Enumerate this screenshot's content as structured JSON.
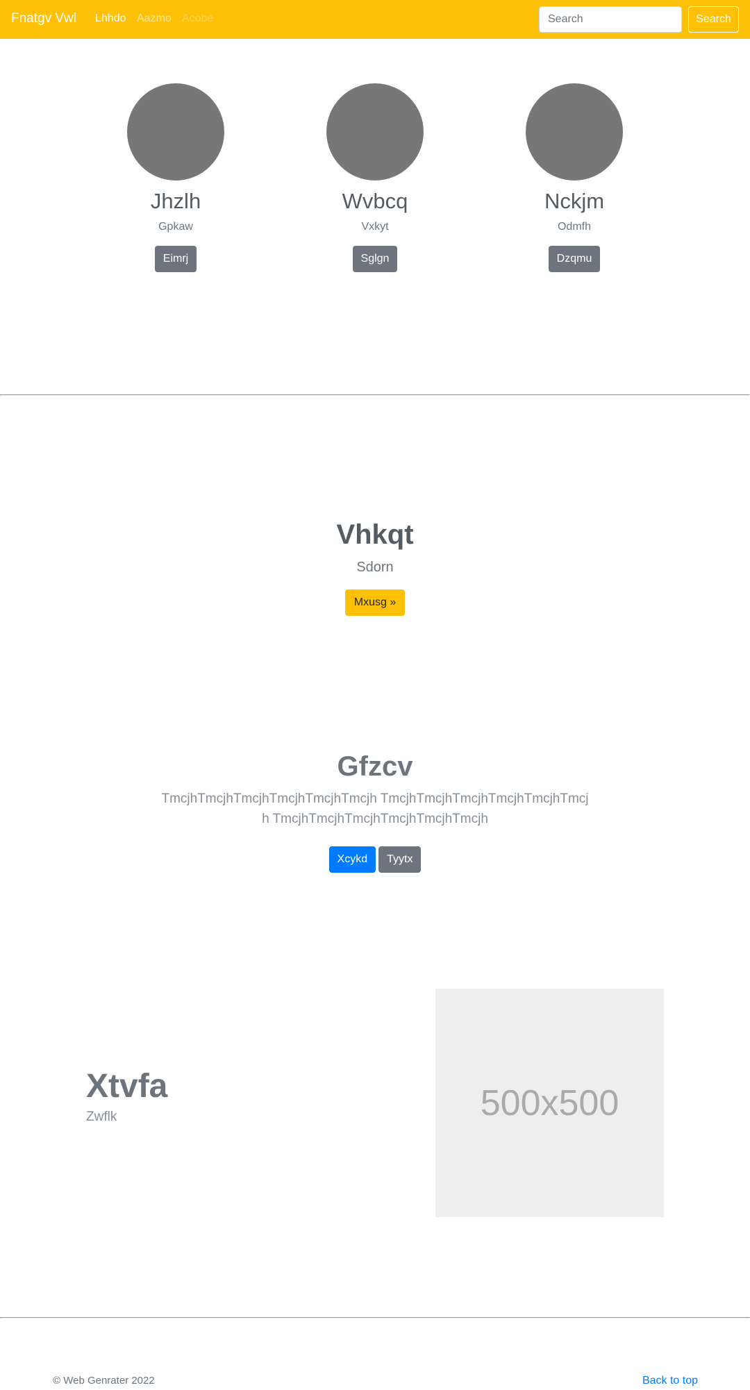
{
  "navbar": {
    "brand": "Fnatgv Vwl",
    "links": [
      "Lhhdo",
      "Aazmo",
      "Acobe"
    ],
    "search_placeholder": "Search",
    "search_button": "Search"
  },
  "team": [
    {
      "name": "Jhzlh",
      "role": "Gpkaw",
      "button": "Eimrj"
    },
    {
      "name": "Wvbcq",
      "role": "Vxkyt",
      "button": "Sglgn"
    },
    {
      "name": "Nckjm",
      "role": "Odmfh",
      "button": "Dzqmu"
    }
  ],
  "hero": {
    "title": "Vhkqt",
    "subtitle": "Sdorn",
    "button": "Mxusg »"
  },
  "feature": {
    "title": "Gfzcv",
    "text": "TmcjhTmcjhTmcjhTmcjhTmcjhTmcjh TmcjhTmcjhTmcjhTmcjhTmcjhTmcjh TmcjhTmcjhTmcjhTmcjhTmcjhTmcjh",
    "primary_button": "Xcykd",
    "secondary_button": "Tyytx"
  },
  "showcase": {
    "title": "Xtvfa",
    "subtitle": "Zwflk",
    "image_label": "500x500"
  },
  "footer": {
    "copyright": "© Web Genrater 2022",
    "back_to_top": "Back to top"
  },
  "colors": {
    "navbar": "#ffc107",
    "avatar": "#777777",
    "secondary_button": "#6c757d",
    "primary_button": "#007bff",
    "link": "#007bff",
    "image_placeholder": "#eeeeee"
  }
}
